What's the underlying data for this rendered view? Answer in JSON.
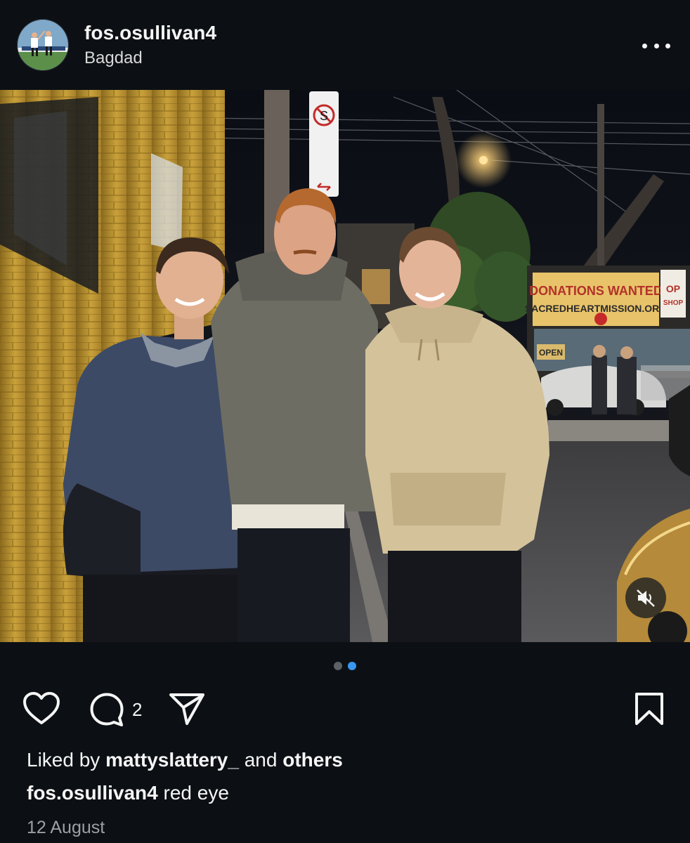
{
  "post": {
    "username": "fos.osullivan4",
    "location": "Bagdad",
    "more_icon": "more-horizontal-icon",
    "photo": {
      "signs": {
        "shop_banner_line1": "DONATIONS WANTED",
        "shop_banner_line2": "SACREDHEARTMISSION.ORG",
        "op_shop_line1": "OP",
        "op_shop_line2": "SHOP",
        "open_sign": "OPEN",
        "parking_sign_symbol": "S"
      },
      "mute_icon": "speaker-muted-icon"
    },
    "carousel": {
      "count": 2,
      "active_index": 1
    },
    "actions": {
      "like_icon": "heart-icon",
      "comment_icon": "comment-bubble-icon",
      "comment_count": "2",
      "share_icon": "paper-plane-icon",
      "save_icon": "bookmark-icon"
    },
    "likes": {
      "prefix": "Liked by",
      "user": "mattyslattery_",
      "conjunction": "and",
      "others": "others"
    },
    "caption": {
      "username": "fos.osullivan4",
      "text": "red eye"
    },
    "date": "12 August"
  },
  "colors": {
    "background": "#0c1014",
    "text": "#f5f5f5",
    "muted_text": "#9aa0a6",
    "active_dot": "#3897f0",
    "inactive_dot": "#5c6166"
  }
}
